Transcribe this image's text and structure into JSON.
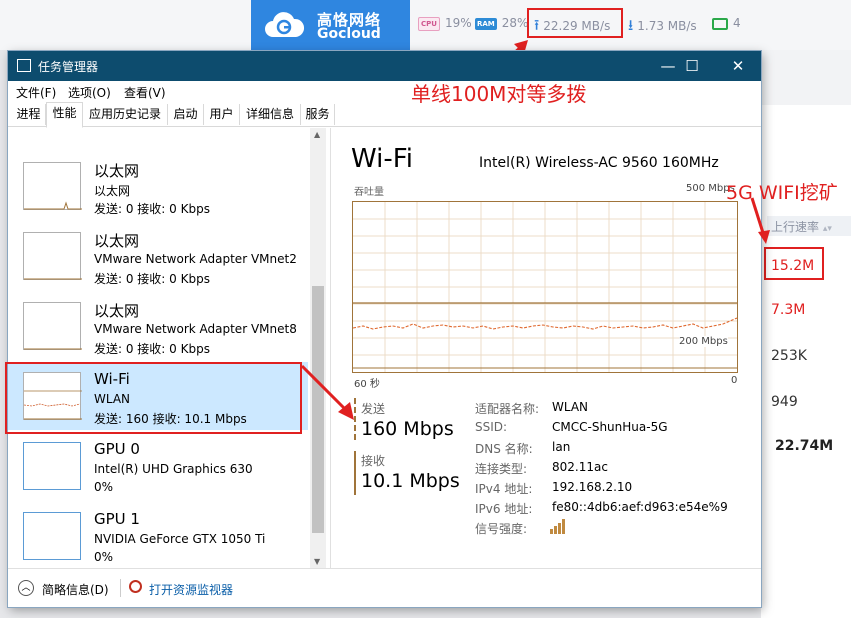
{
  "topbar": {
    "logo_cn": "高恪网络",
    "logo_en": "Gocloud",
    "cpu_chip": "CPU",
    "cpu_pct": "19%",
    "ram_chip": "RAM",
    "ram_pct": "28%",
    "upload_speed": "22.29 MB/s",
    "download_speed": "1.73 MB/s",
    "devices": "4",
    "colors": {
      "logo_bg": "#2f86e0",
      "accent": "#2f7fd8",
      "ok": "#2aa84a"
    }
  },
  "annotations": {
    "top_note": "单线100M对等多拨",
    "right_note": "5G WIFI挖矿"
  },
  "right_panel": {
    "header": "上行速率",
    "values": [
      "15.2M",
      "7.3M",
      "253K",
      "949",
      "22.74M"
    ]
  },
  "window": {
    "title": "任务管理器",
    "menu": [
      "文件(F)",
      "选项(O)",
      "查看(V)"
    ],
    "tabs": [
      "进程",
      "性能",
      "应用历史记录",
      "启动",
      "用户",
      "详细信息",
      "服务"
    ],
    "active_tab": "性能",
    "devices": [
      {
        "name": "以太网",
        "sub": "以太网",
        "stat": "发送: 0 接收: 0 Kbps"
      },
      {
        "name": "以太网",
        "sub": "VMware Network Adapter VMnet2",
        "stat": "发送: 0 接收: 0 Kbps"
      },
      {
        "name": "以太网",
        "sub": "VMware Network Adapter VMnet8",
        "stat": "发送: 0 接收: 0 Kbps"
      },
      {
        "name": "Wi-Fi",
        "sub": "WLAN",
        "stat": "发送: 160 接收: 10.1 Mbps"
      },
      {
        "name": "GPU 0",
        "sub": "Intel(R) UHD Graphics 630",
        "stat": "0%"
      },
      {
        "name": "GPU 1",
        "sub": "NVIDIA GeForce GTX 1050 Ti",
        "stat": "0%"
      }
    ],
    "detail": {
      "title": "Wi-Fi",
      "adapter": "Intel(R) Wireless-AC 9560 160MHz",
      "throughput_label": "吞吐量",
      "max_label": "500 Mbps",
      "mid_label": "200 Mbps",
      "x_left": "60 秒",
      "x_right": "0",
      "send_label": "发送",
      "send_value": "160 Mbps",
      "recv_label": "接收",
      "recv_value": "10.1 Mbps",
      "props": [
        {
          "label": "适配器名称:",
          "value": "WLAN"
        },
        {
          "label": "SSID:",
          "value": "CMCC-ShunHua-5G"
        },
        {
          "label": "DNS 名称:",
          "value": "lan"
        },
        {
          "label": "连接类型:",
          "value": "802.11ac"
        },
        {
          "label": "IPv4 地址:",
          "value": "192.168.2.10"
        },
        {
          "label": "IPv6 地址:",
          "value": "fe80::4db6:aef:d963:e54e%9"
        },
        {
          "label": "信号强度:",
          "value": ""
        }
      ]
    },
    "footer": {
      "less_details": "简略信息(D)",
      "open_monitor": "打开资源监视器"
    }
  }
}
